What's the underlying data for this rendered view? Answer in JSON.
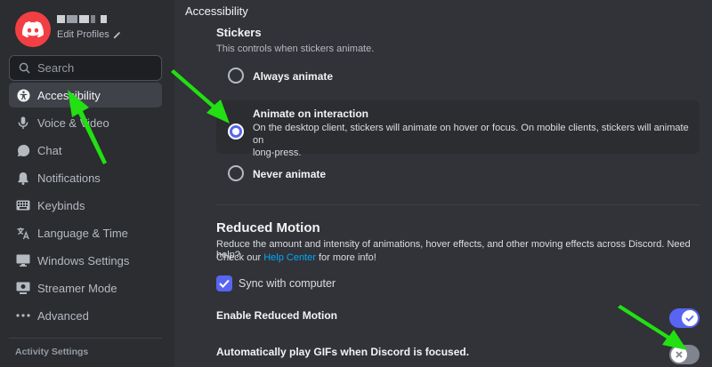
{
  "profile": {
    "edit_label": "Edit Profiles"
  },
  "search": {
    "placeholder": "Search"
  },
  "sidebar": {
    "items": [
      {
        "label": "Accessibility",
        "icon": "accessibility-icon"
      },
      {
        "label": "Voice & Video",
        "icon": "microphone-icon"
      },
      {
        "label": "Chat",
        "icon": "chat-bubble-icon"
      },
      {
        "label": "Notifications",
        "icon": "bell-icon"
      },
      {
        "label": "Keybinds",
        "icon": "keyboard-icon"
      },
      {
        "label": "Language & Time",
        "icon": "language-icon"
      },
      {
        "label": "Windows Settings",
        "icon": "monitor-icon"
      },
      {
        "label": "Streamer Mode",
        "icon": "streamer-icon"
      },
      {
        "label": "Advanced",
        "icon": "ellipsis-icon"
      }
    ],
    "footer_heading": "Activity Settings"
  },
  "main": {
    "section_title": "Accessibility",
    "stickers": {
      "title": "Stickers",
      "description": "This controls when stickers animate.",
      "options": [
        {
          "label": "Always animate",
          "selected": false,
          "description": ""
        },
        {
          "label": "Animate on interaction",
          "selected": true,
          "description_line1": "On the desktop client, stickers will animate on hover or focus. On mobile clients, stickers will animate on",
          "description_line2": "long-press."
        },
        {
          "label": "Never animate",
          "selected": false,
          "description": ""
        }
      ]
    },
    "reduced_motion": {
      "title": "Reduced Motion",
      "description_line1": "Reduce the amount and intensity of animations, hover effects, and other moving effects across Discord. Need help?",
      "description_pre_link": "Check our ",
      "link_text": "Help Center",
      "description_post_link": " for more info!",
      "sync_label": "Sync with computer",
      "sync_checked": true,
      "enable_label": "Enable Reduced Motion",
      "enable_on": true,
      "gif_label": "Automatically play GIFs when Discord is focused.",
      "gif_on": false
    }
  },
  "colors": {
    "accent": "#5865f2",
    "brand_red": "#f23f43",
    "annotation_arrow": "#22e012",
    "link": "#00a8fc"
  }
}
